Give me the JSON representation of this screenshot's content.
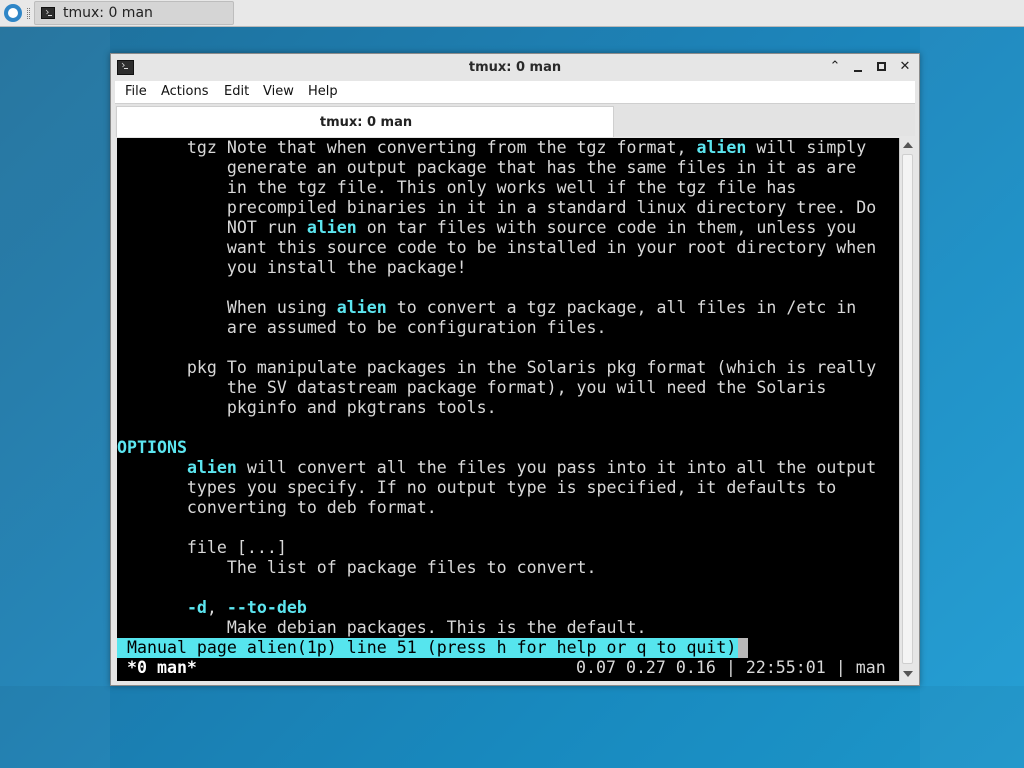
{
  "taskbar": {
    "task_label": "tmux: 0 man"
  },
  "window": {
    "title": "tmux: 0 man",
    "menu": [
      "File",
      "Actions",
      "Edit",
      "View",
      "Help"
    ],
    "tab_label": "tmux: 0 man"
  },
  "terminal": {
    "lines": [
      [
        "       tgz Note that when converting from the tgz format, ",
        "alien",
        " will simply"
      ],
      [
        "           generate an output package that has the same files in it as are"
      ],
      [
        "           in the tgz file. This only works well if the tgz file has"
      ],
      [
        "           precompiled binaries in it in a standard linux directory tree. Do"
      ],
      [
        "           NOT run ",
        "alien",
        " on tar files with source code in them, unless you"
      ],
      [
        "           want this source code to be installed in your root directory when"
      ],
      [
        "           you install the package!"
      ],
      [
        ""
      ],
      [
        "           When using ",
        "alien",
        " to convert a tgz package, all files in /etc in"
      ],
      [
        "           are assumed to be configuration files."
      ],
      [
        ""
      ],
      [
        "       pkg To manipulate packages in the Solaris pkg format (which is really"
      ],
      [
        "           the SV datastream package format), you will need the Solaris"
      ],
      [
        "           pkginfo and pkgtrans tools."
      ],
      [
        ""
      ],
      [
        "",
        "OPTIONS"
      ],
      [
        "       ",
        "alien",
        " will convert all the files you pass into it into all the output"
      ],
      [
        "       types you specify. If no output type is specified, it defaults to"
      ],
      [
        "       converting to deb format."
      ],
      [
        ""
      ],
      [
        "       file [...]"
      ],
      [
        "           The list of package files to convert."
      ],
      [
        ""
      ],
      [
        "       ",
        "-d",
        ", ",
        "--to-deb"
      ],
      [
        "           Make debian packages. This is the default."
      ]
    ],
    "man_status": " Manual page alien(1p) line 51 (press h for help or q to quit)",
    "tmux_left": " *0 man*",
    "tmux_right": "0.07 0.27 0.16 | 22:55:01 | man"
  },
  "colors": {
    "highlight": "#5ce6f0",
    "status_bar": "#56e5ee",
    "terminal_bg": "#000000"
  },
  "icons": [
    "start-menu-icon",
    "terminal-icon",
    "shade-icon",
    "minimize-icon",
    "maximize-icon",
    "close-icon"
  ]
}
